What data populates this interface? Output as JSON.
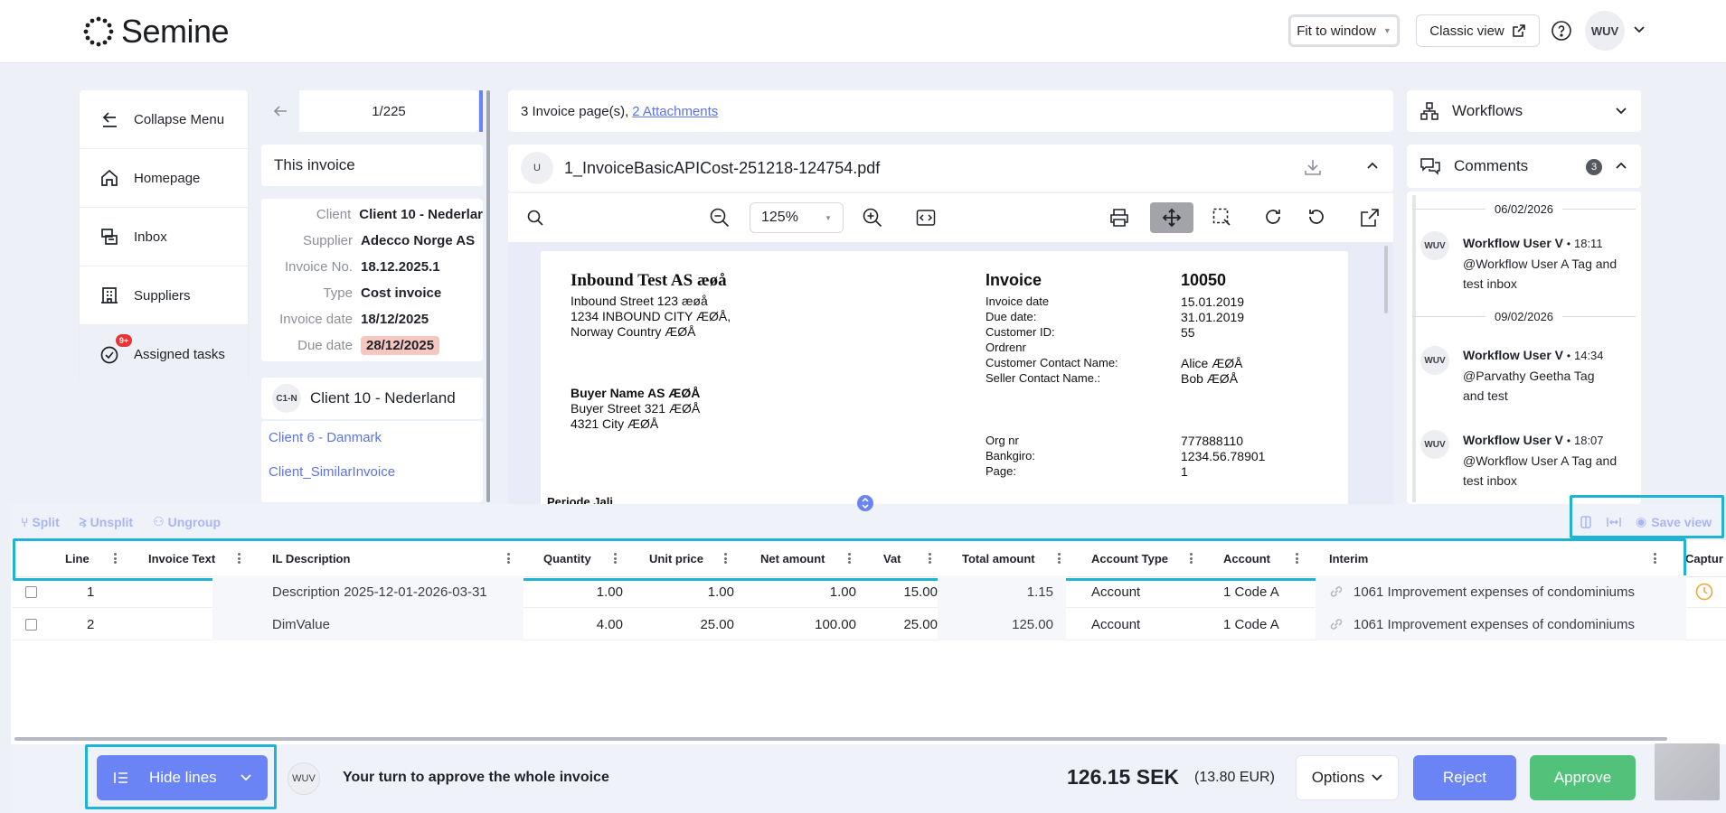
{
  "header": {
    "brand": "Semine",
    "fit_label": "Fit to window",
    "classic_label": "Classic view",
    "user_initials": "WUV"
  },
  "sidebar": {
    "items": [
      {
        "label": "Collapse Menu",
        "icon": "arrow-left-bar-icon"
      },
      {
        "label": "Homepage",
        "icon": "home-icon"
      },
      {
        "label": "Inbox",
        "icon": "inbox-icon"
      },
      {
        "label": "Suppliers",
        "icon": "building-icon"
      },
      {
        "label": "Assigned tasks",
        "icon": "check-circle-icon",
        "badge": "9+"
      }
    ]
  },
  "invoice_nav": {
    "position": "1/225",
    "section_title": "This invoice",
    "fields": [
      {
        "key": "Client",
        "value": "Client 10 - Nederlar"
      },
      {
        "key": "Supplier",
        "value": "Adecco Norge AS"
      },
      {
        "key": "Invoice No.",
        "value": "18.12.2025.1"
      },
      {
        "key": "Type",
        "value": "Cost invoice"
      },
      {
        "key": "Invoice date",
        "value": "18/12/2025"
      },
      {
        "key": "Due date",
        "value": "28/12/2025"
      }
    ],
    "client_badge": "C1-N",
    "client_name": "Client 10 - Nederland",
    "links": [
      "Client 6 - Danmark",
      "Client_SimilarInvoice"
    ]
  },
  "document": {
    "pages_text": "3 Invoice page(s),",
    "attachments_link": "2 Attachments",
    "file_badge": "U",
    "file_name": "1_InvoiceBasicAPICost-251218-124754.pdf",
    "zoom": "125%"
  },
  "pdf": {
    "company": "Inbound Test AS æøå",
    "address": [
      "Inbound Street 123 æøå",
      "1234 INBOUND CITY ÆØÅ,",
      "Norway Country ÆØÅ"
    ],
    "buyer": "Buyer Name AS ÆØÅ",
    "buyer_address": [
      "Buyer Street 321 ÆØÅ",
      "4321 City ÆØÅ"
    ],
    "invoice_label": "Invoice",
    "invoice_number": "10050",
    "labels": [
      "Invoice date",
      "Due date:",
      "Customer ID:",
      "Ordrenr",
      "Customer Contact Name:",
      "Seller Contact Name.:"
    ],
    "values": [
      "15.01.2019",
      "31.01.2019",
      "55",
      "",
      "Alice ÆØÅ",
      "Bob ÆØÅ"
    ],
    "labels2": [
      "Org nr",
      "Bankgiro:",
      "Page:"
    ],
    "values2": [
      "777888110",
      "1234.56.78901",
      "1"
    ],
    "cut_text": "Periode Jali..."
  },
  "workflows": {
    "label": "Workflows"
  },
  "comments": {
    "label": "Comments",
    "count": "3",
    "items": [
      {
        "date": "06/02/2026",
        "initials": "WUV",
        "author": "Workflow User V",
        "time": "18:11",
        "text1": "@Workflow User A Tag and",
        "text2": "test inbox"
      },
      {
        "date": "09/02/2026",
        "initials": "WUV",
        "author": "Workflow User V",
        "time": "14:34",
        "text1": "@Parvathy Geetha Tag",
        "text2": "and test"
      },
      {
        "date": "",
        "initials": "WUV",
        "author": "Workflow User V",
        "time": "18:07",
        "text1": "@Workflow User A Tag and",
        "text2": "test inbox"
      }
    ]
  },
  "lines_toolbar": {
    "split": "Split",
    "unsplit": "Unsplit",
    "ungroup": "Ungroup",
    "save_view": "Save view"
  },
  "table": {
    "columns": [
      "Line",
      "Invoice Text",
      "IL Description",
      "Quantity",
      "Unit price",
      "Net amount",
      "Vat",
      "Total amount",
      "Account Type",
      "Account",
      "Interim",
      "Captur"
    ],
    "rows": [
      {
        "line": "1",
        "text": "",
        "desc": "Description 2025-12-01-2026-03-31",
        "qty": "1.00",
        "unit": "1.00",
        "net": "1.00",
        "vat": "15.00",
        "total": "1.15",
        "acct_type": "Account",
        "account": "1 Code A",
        "interim": "1061 Improvement expenses of condominiums"
      },
      {
        "line": "2",
        "text": "",
        "desc": "DimValue",
        "qty": "4.00",
        "unit": "25.00",
        "net": "100.00",
        "vat": "25.00",
        "total": "125.00",
        "acct_type": "Account",
        "account": "1 Code A",
        "interim": "1061 Improvement expenses of condominiums"
      }
    ]
  },
  "footer": {
    "hide_lines": "Hide lines",
    "initials": "WUV",
    "message": "Your turn to approve the whole invoice",
    "total": "126.15 SEK",
    "total_eur": "(13.80 EUR)",
    "options": "Options",
    "reject": "Reject",
    "approve": "Approve"
  },
  "colors": {
    "accent": "#6b84f5",
    "approve": "#52c27a",
    "due_badge": "#f6c6c0",
    "highlight": "#21b3d3",
    "link": "#5b74e8"
  }
}
